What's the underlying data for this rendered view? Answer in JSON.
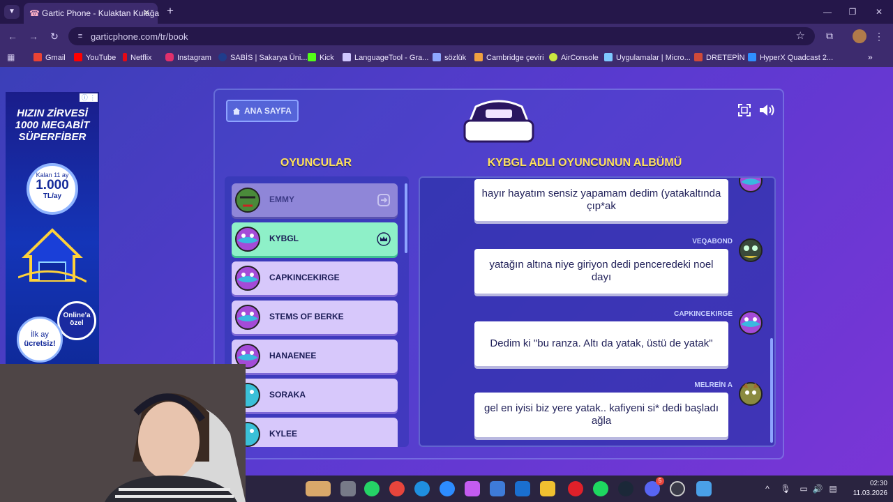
{
  "browser": {
    "tab_title": "Gartic Phone - Kulaktan Kulağa",
    "url": "garticphone.com/tr/book",
    "bookmarks": [
      {
        "label": "Gmail",
        "color": "#ea4335"
      },
      {
        "label": "YouTube",
        "color": "#ff0000"
      },
      {
        "label": "Netflix",
        "color": "#e50914"
      },
      {
        "label": "Instagram",
        "color": "#e1306c"
      },
      {
        "label": "SABİS | Sakarya Üni...",
        "color": "#1f3c8c"
      },
      {
        "label": "Kick",
        "color": "#53fc18"
      },
      {
        "label": "LanguageTool - Gra...",
        "color": "#cfc6ff"
      },
      {
        "label": "sözlük",
        "color": "#8fa8ff"
      },
      {
        "label": "Cambridge çeviri",
        "color": "#f0a040"
      },
      {
        "label": "AirConsole",
        "color": "#c9e640"
      },
      {
        "label": "Uygulamalar | Micro...",
        "color": "#7ec8ff"
      },
      {
        "label": "DRETEPİN",
        "color": "#d04a3a"
      },
      {
        "label": "HyperX Quadcast 2...",
        "color": "#2f8fff"
      }
    ]
  },
  "ad": {
    "info_label": "ⓘ ⋮",
    "headline": "HIZIN ZİRVESİ 1000 MEGABİT SÜPERFİBER",
    "price_top": "Kalan 11 ay",
    "price_main": "1.000",
    "price_unit": "TL/ay",
    "online_badge": "Online'a özel",
    "free_top": "İlk ay",
    "free_main": "ücretsiz!"
  },
  "game": {
    "home_button": "ANA SAYFA",
    "players_title": "OYUNCULAR",
    "album_title": "KYBGL ADLI OYUNCUNUN ALBÜMÜ",
    "players": [
      {
        "name": "EMMY",
        "state": "disconnected"
      },
      {
        "name": "KYBGL",
        "state": "active"
      },
      {
        "name": "CAPKINCEKIRGE",
        "state": "normal"
      },
      {
        "name": "STEMS OF BERKE",
        "state": "normal"
      },
      {
        "name": "HANAENEE",
        "state": "normal"
      },
      {
        "name": "SORAKA",
        "state": "normal"
      },
      {
        "name": "KYLEE",
        "state": "normal"
      }
    ],
    "album": [
      {
        "author": "",
        "text": "hayır hayatım sensiz yapamam dedim (yatakaltında çıp*ak"
      },
      {
        "author": "VEQABOND",
        "text": "yatağın altına niye giriyon dedi penceredeki noel dayı"
      },
      {
        "author": "CAPKINCEKIRGE",
        "text": "Dedim ki \"bu ranza. Altı da yatak, üstü de yatak\""
      },
      {
        "author": "MELREİN A",
        "text": "gel en iyisi biz yere yatak.. kafiyeni si* dedi başladı ağla"
      }
    ]
  },
  "taskbar": {
    "time": "02:30",
    "date": "11.03.2026",
    "discord_badge": "5"
  }
}
